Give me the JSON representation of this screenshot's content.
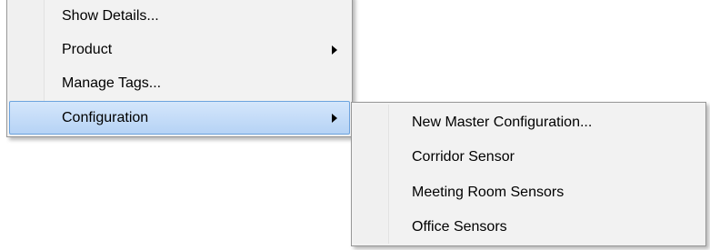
{
  "context_menu": {
    "items": [
      {
        "label": "Show Details...",
        "has_submenu": false
      },
      {
        "label": "Product",
        "has_submenu": true
      },
      {
        "label": "Manage Tags...",
        "has_submenu": false
      },
      {
        "label": "Configuration",
        "has_submenu": true,
        "highlighted": true
      }
    ]
  },
  "configuration_submenu": {
    "items": [
      {
        "label": "New Master Configuration..."
      },
      {
        "label": "Corridor Sensor"
      },
      {
        "label": "Meeting Room Sensors"
      },
      {
        "label": "Office Sensors"
      }
    ]
  },
  "colors": {
    "menu_background": "#f2f2f2",
    "menu_border": "#979797",
    "highlight_fill": "#c5ddf8",
    "highlight_border": "#6ca3de"
  },
  "icons": {
    "submenu_arrow": "chevron-right-icon"
  }
}
